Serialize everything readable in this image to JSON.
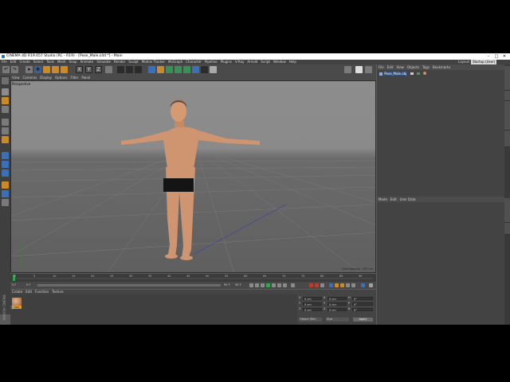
{
  "window": {
    "title": "CINEMA 4D R19.057 Studio (RC - R19) - [Pose_Male.c4d *] - Main",
    "controls": [
      "–",
      "□",
      "✕"
    ]
  },
  "menu": [
    "File",
    "Edit",
    "Create",
    "Select",
    "Tools",
    "Mesh",
    "Snap",
    "Animate",
    "Simulate",
    "Render",
    "Sculpt",
    "Motion Tracker",
    "MoGraph",
    "Character",
    "Pipeline",
    "Plugins",
    "V-Ray",
    "Arnold",
    "Script",
    "Window",
    "Help"
  ],
  "layout": {
    "label": "Layout:",
    "value": "Startup (User)"
  },
  "viewport_menu": [
    "View",
    "Cameras",
    "Display",
    "Options",
    "Filter",
    "Panel"
  ],
  "viewport": {
    "camera": "Perspective",
    "grid_info": "Grid Spacing : 100 cm"
  },
  "timeline": {
    "ticks": [
      "0",
      "5",
      "10",
      "15",
      "20",
      "25",
      "30",
      "35",
      "40",
      "45",
      "50",
      "55",
      "60",
      "65",
      "70",
      "75",
      "80",
      "85",
      "90"
    ],
    "frame_start": "0 F",
    "frame_current": "0 F",
    "frame_end": "90 F",
    "frame_max": "90 F"
  },
  "material_menu": [
    "Create",
    "Edit",
    "Function",
    "Texture"
  ],
  "material": {
    "name": "Mat"
  },
  "coordinates": {
    "rows": [
      {
        "axis": "X",
        "pos": "0 cm",
        "axis2": "X",
        "size": "0 cm",
        "axis3": "H",
        "rot": "0°"
      },
      {
        "axis": "Y",
        "pos": "0 cm",
        "axis2": "Y",
        "size": "0 cm",
        "axis3": "P",
        "rot": "0°"
      },
      {
        "axis": "Z",
        "pos": "0 cm",
        "axis2": "Z",
        "size": "0 cm",
        "axis3": "B",
        "rot": "0°"
      }
    ],
    "mode1": "Object (Rel)",
    "mode2": "Size",
    "apply": "Apply"
  },
  "object_menu": [
    "File",
    "Edit",
    "View",
    "Objects",
    "Tags",
    "Bookmarks"
  ],
  "objects": [
    {
      "name": "Pose_Male.obj"
    }
  ],
  "attributes_menu": [
    "Mode",
    "Edit",
    "User Data"
  ],
  "side_tabs": [
    "Objects",
    "Takes",
    "Content Browser",
    "Structure",
    "Attributes",
    "Layers"
  ],
  "brand": "MAXON CINEMA 4D",
  "colors": {
    "app_bg": "#5b5b5b",
    "accent_blue": "#3a5f96",
    "skin": "#d59a72",
    "trunks": "#141414"
  }
}
